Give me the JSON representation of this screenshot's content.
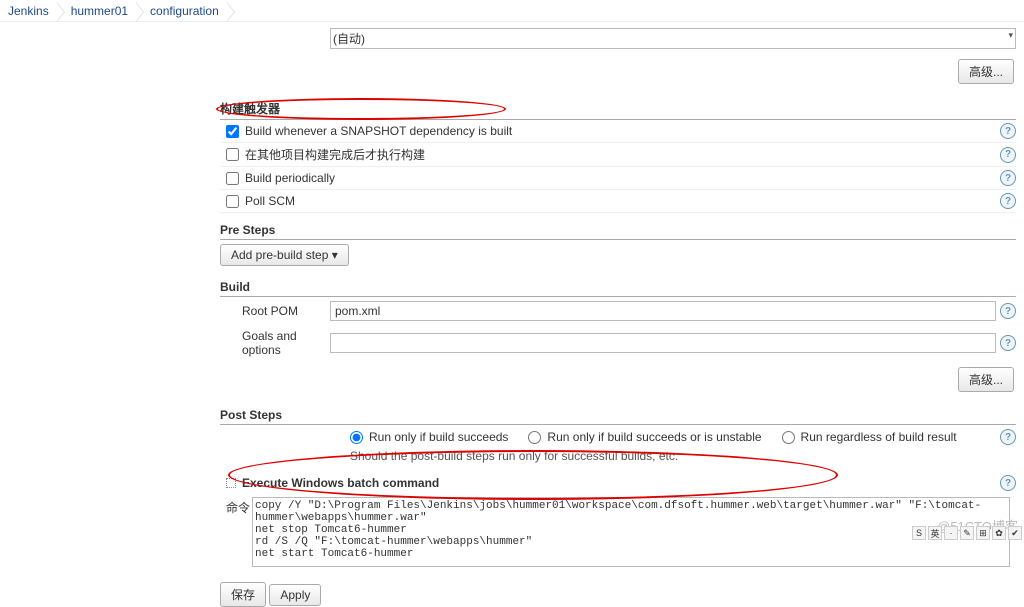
{
  "breadcrumb": {
    "a": "Jenkins",
    "b": "hummer01",
    "c": "configuration"
  },
  "top": {
    "auto": "(自动)",
    "adv1": "高级..."
  },
  "triggers": {
    "title": "构建触发器",
    "snapshot": "Build whenever a SNAPSHOT dependency is built",
    "afterOther": "在其他项目构建完成后才执行构建",
    "periodic": "Build periodically",
    "pollscm": "Poll SCM"
  },
  "presteps": {
    "title": "Pre Steps",
    "addBtn": "Add pre-build step ▾"
  },
  "build": {
    "title": "Build",
    "rootPomLabel": "Root POM",
    "rootPomVal": "pom.xml",
    "goalsLabel": "Goals and options",
    "goalsVal": "",
    "adv2": "高级..."
  },
  "poststeps": {
    "title": "Post Steps",
    "r1": "Run only if build succeeds",
    "r2": "Run only if build succeeds or is unstable",
    "r3": "Run regardless of build result",
    "note": "Should the post-build steps run only for successful builds, etc."
  },
  "exec": {
    "title": "Execute Windows batch command",
    "cmdLabel": "命令",
    "cmd": "copy /Y \"D:\\Program Files\\Jenkins\\jobs\\hummer01\\workspace\\com.dfsoft.hummer.web\\target\\hummer.war\" \"F:\\tomcat-hummer\\webapps\\hummer.war\"\nnet stop Tomcat6-hummer\nrd /S /Q \"F:\\tomcat-hummer\\webapps\\hummer\"\nnet start Tomcat6-hummer"
  },
  "bottom": {
    "save": "保存",
    "apply": "Apply"
  },
  "watermark": "@51CTO博客"
}
